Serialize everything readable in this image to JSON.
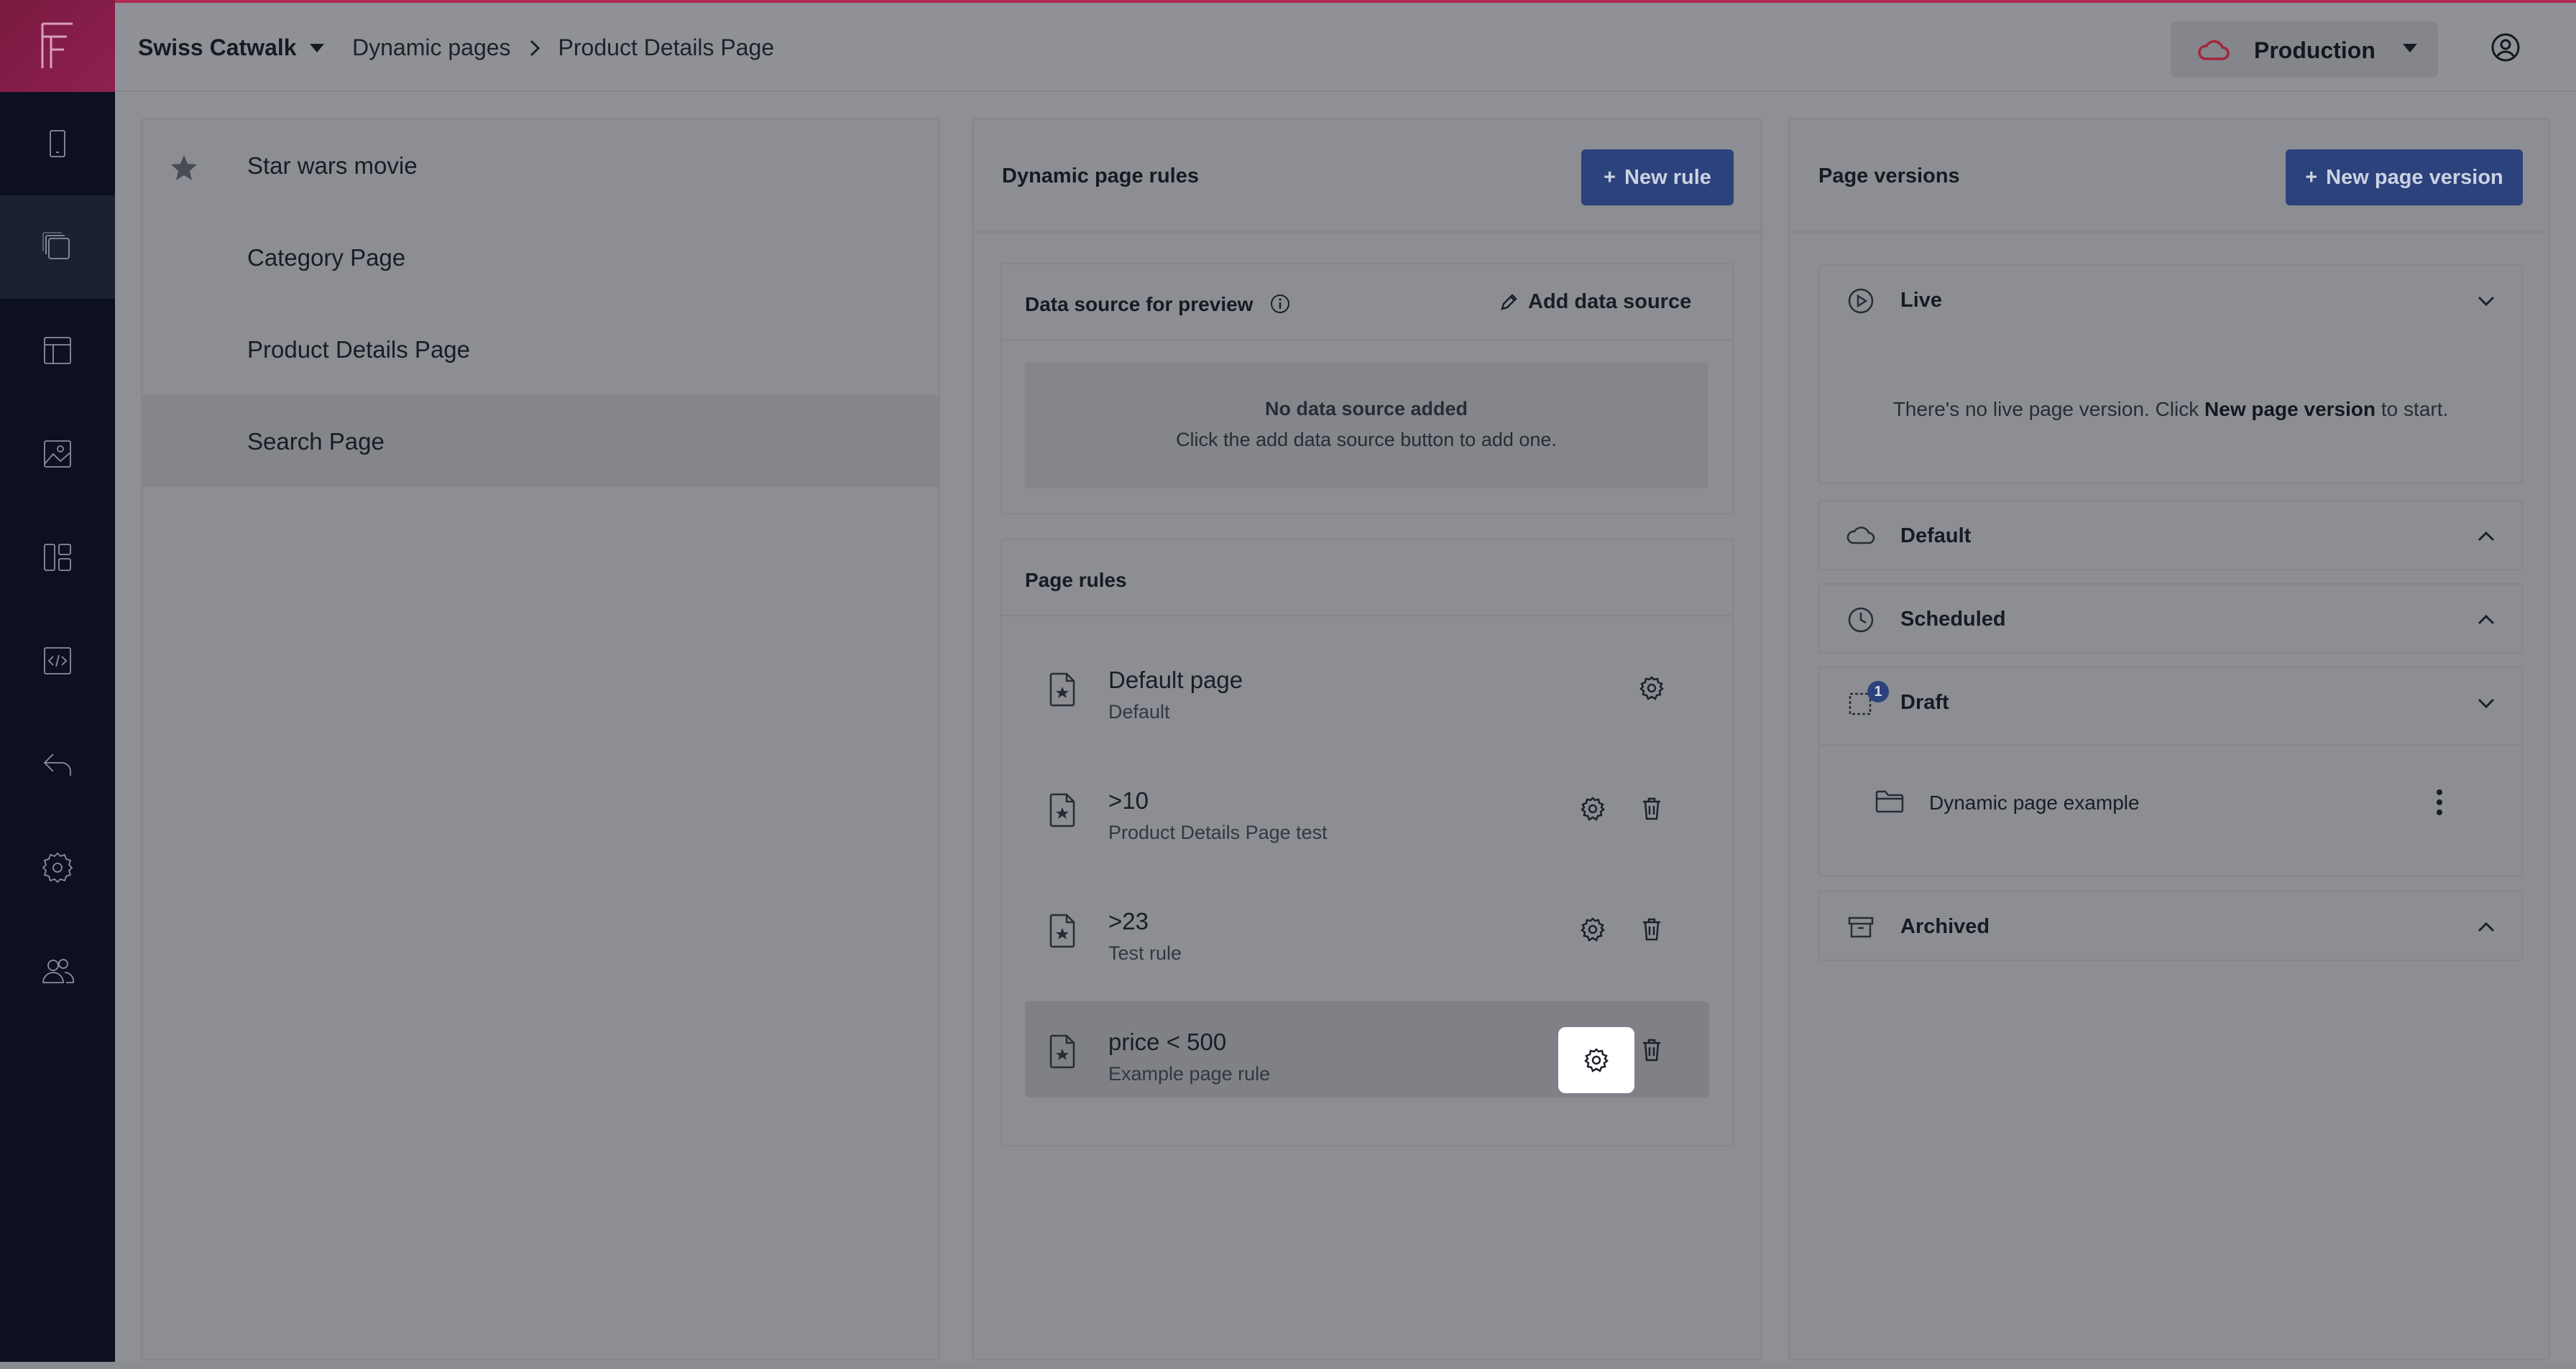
{
  "header": {
    "brand": "Swiss Catwalk",
    "breadcrumb": [
      "Dynamic pages",
      "Product Details Page"
    ],
    "environment": "Production"
  },
  "sidebar": {
    "items": [
      "device",
      "pages",
      "layout",
      "media",
      "widgets",
      "code",
      "back",
      "settings",
      "users"
    ],
    "active_index": 1
  },
  "pages_list": {
    "items": [
      {
        "label": "Star wars movie",
        "starred": true
      },
      {
        "label": "Category Page",
        "starred": false
      },
      {
        "label": "Product Details Page",
        "starred": false
      },
      {
        "label": "Search Page",
        "starred": false,
        "selected": true
      }
    ]
  },
  "rules_panel": {
    "title": "Dynamic page rules",
    "new_rule_label": "New rule",
    "data_source": {
      "title": "Data source for preview",
      "add_label": "Add data source",
      "empty_title": "No data source added",
      "empty_text": "Click the add data source button to add one."
    },
    "page_rules": {
      "title": "Page rules",
      "rules": [
        {
          "title": "Default page",
          "subtitle": "Default",
          "deletable": false
        },
        {
          "title": ">10",
          "subtitle": "Product Details Page test",
          "deletable": true
        },
        {
          "title": ">23",
          "subtitle": "Test rule",
          "deletable": true
        },
        {
          "title": "price < 500",
          "subtitle": "Example page rule",
          "deletable": true,
          "active": true
        }
      ]
    }
  },
  "versions_panel": {
    "title": "Page versions",
    "new_version_label": "New page version",
    "sections": {
      "live": {
        "title": "Live",
        "empty_prefix": "There's no live page version. Click ",
        "empty_link": "New page version",
        "empty_suffix": " to start."
      },
      "default": {
        "title": "Default"
      },
      "scheduled": {
        "title": "Scheduled"
      },
      "draft": {
        "title": "Draft",
        "badge": "1",
        "items": [
          "Dynamic page example"
        ]
      },
      "archived": {
        "title": "Archived"
      }
    }
  },
  "colors": {
    "primary": "#2c427c",
    "brand": "#b02b55",
    "sidebar": "#0c1020"
  }
}
